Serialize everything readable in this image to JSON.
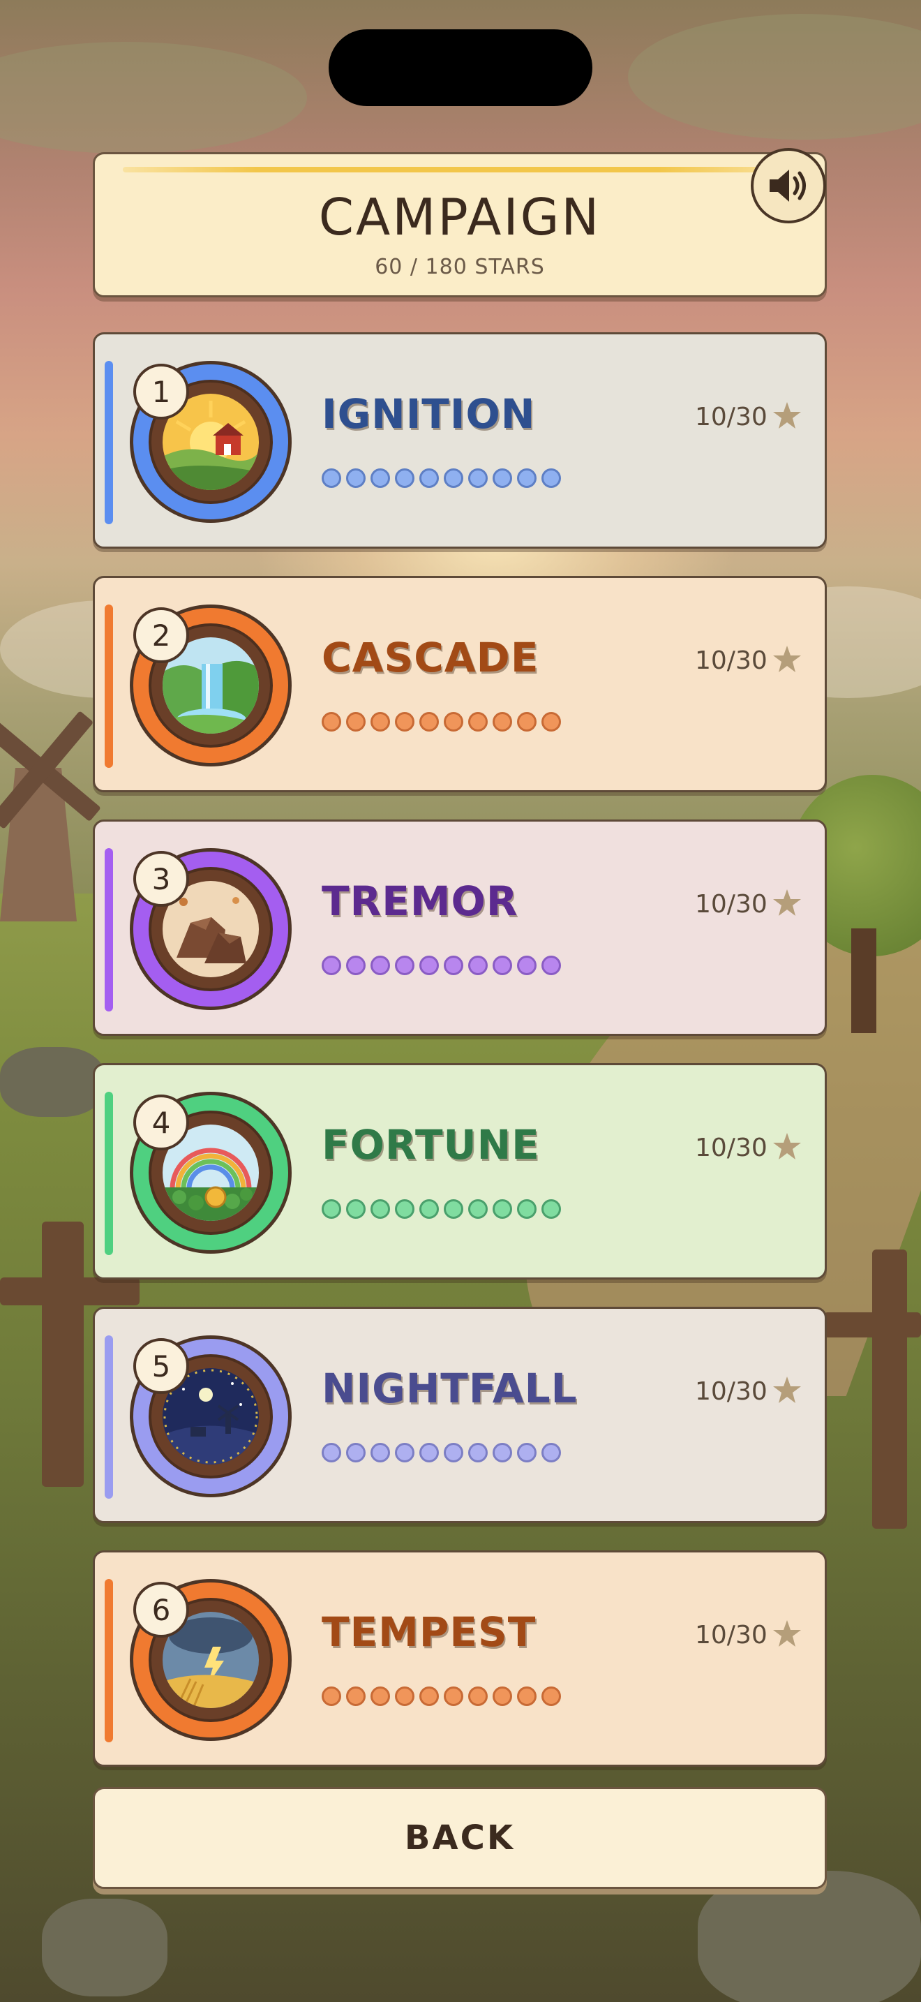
{
  "screen": {
    "title": "CAMPAIGN",
    "stars_total": "60 / 180 STARS"
  },
  "levels": [
    {
      "number": "1",
      "name": "IGNITION",
      "stars": "10/30",
      "theme": "farm-sunrise",
      "accent": "#5b8ef0",
      "name_color": "#2e4f8f",
      "card_bg": "#e6e3da",
      "ring": "#5b8ef0",
      "dot_fill": "#8fb0f0",
      "dot_border": "#5e7fc4",
      "dots_total": 10,
      "dots_filled": 10
    },
    {
      "number": "2",
      "name": "CASCADE",
      "stars": "10/30",
      "theme": "waterfall",
      "accent": "#f07a30",
      "name_color": "#a24a16",
      "card_bg": "#f8e2c8",
      "ring": "#f07a30",
      "dot_fill": "#f0955a",
      "dot_border": "#c86a35",
      "dots_total": 10,
      "dots_filled": 10
    },
    {
      "number": "3",
      "name": "TREMOR",
      "stars": "10/30",
      "theme": "rocks",
      "accent": "#a45ef0",
      "name_color": "#5c2a8f",
      "card_bg": "#f0e0de",
      "ring": "#a45ef0",
      "dot_fill": "#b886ee",
      "dot_border": "#8a5cc4",
      "dots_total": 10,
      "dots_filled": 10
    },
    {
      "number": "4",
      "name": "FORTUNE",
      "stars": "10/30",
      "theme": "rainbow-clover",
      "accent": "#4fd080",
      "name_color": "#2f7a48",
      "card_bg": "#e2efcf",
      "ring": "#4fd080",
      "dot_fill": "#80dca0",
      "dot_border": "#4aa06c",
      "dots_total": 10,
      "dots_filled": 10
    },
    {
      "number": "5",
      "name": "NIGHTFALL",
      "stars": "10/30",
      "theme": "night-windmill",
      "accent": "#9a9cf0",
      "name_color": "#4a4c8f",
      "card_bg": "#ebe4dc",
      "ring": "#9a9cf0",
      "dot_fill": "#aeb0f0",
      "dot_border": "#7c7ec4",
      "dots_total": 10,
      "dots_filled": 10
    },
    {
      "number": "6",
      "name": "TEMPEST",
      "stars": "10/30",
      "theme": "storm",
      "accent": "#f07a30",
      "name_color": "#a24a16",
      "card_bg": "#f8e2c8",
      "ring": "#f07a30",
      "dot_fill": "#f0955a",
      "dot_border": "#c86a35",
      "dots_total": 10,
      "dots_filled": 10
    }
  ],
  "buttons": {
    "back": "BACK",
    "sound_icon": "speaker-icon"
  }
}
